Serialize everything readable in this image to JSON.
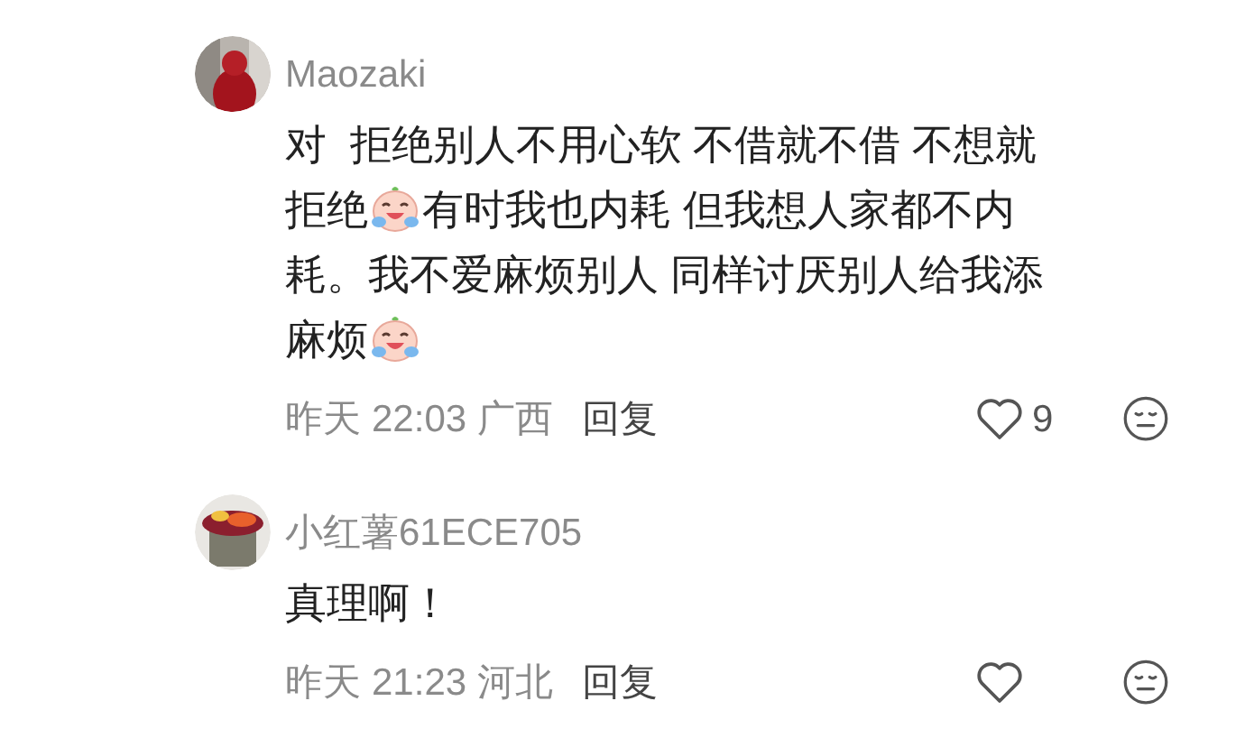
{
  "comments": [
    {
      "username": "Maozaki",
      "avatar": {
        "kind": "picture"
      },
      "lines": [
        [
          {
            "kind": "text",
            "text": "对  拒绝别人不用心软 不借就不借 不想就"
          }
        ],
        [
          {
            "kind": "text",
            "text": "拒绝"
          },
          {
            "kind": "emoji"
          },
          {
            "kind": "text",
            "text": "有时我也内耗 但我想人家都不内"
          }
        ],
        [
          {
            "kind": "text",
            "text": "耗。我不爱麻烦别人 同样讨厌别人给我添"
          }
        ],
        [
          {
            "kind": "text",
            "text": "麻烦"
          },
          {
            "kind": "emoji"
          }
        ]
      ],
      "date": "昨天",
      "time": "22:03",
      "location": "广西",
      "reply": "回复",
      "likes": "9"
    },
    {
      "username": "小红薯61ECE705",
      "avatar": {
        "kind": "picture"
      },
      "lines": [
        [
          {
            "kind": "text",
            "text": "真理啊！"
          }
        ]
      ],
      "date": "昨天",
      "time": "21:23",
      "location": "河北",
      "reply": "回复"
    }
  ]
}
